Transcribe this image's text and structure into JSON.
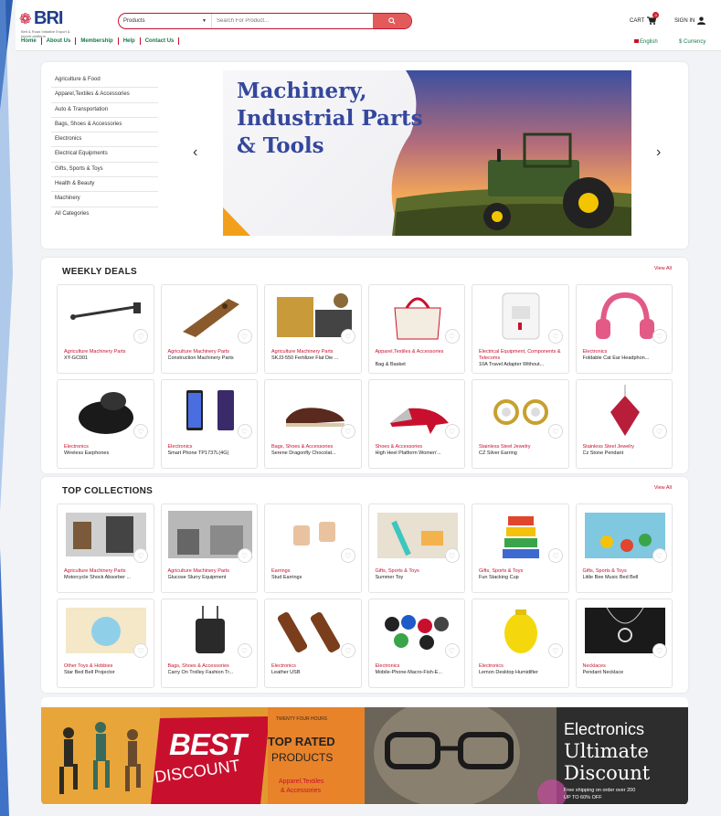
{
  "header": {
    "logo_text": "BRI",
    "logo_sub": "Belt & Road Initiative Export & Import platform",
    "search_category": "Products",
    "search_placeholder": "Search For Product...",
    "cart_label": "CART",
    "cart_count": "0",
    "signin_label": "SIGN IN"
  },
  "nav": [
    "Home",
    "About Us",
    "Membership",
    "Help",
    "Contact Us"
  ],
  "lang": "English",
  "currency": "$ Currency",
  "categories": [
    "Agriculture & Food",
    "Apparel,Textiles & Accessories",
    "Auto & Transportation",
    "Bags, Shoes & Accessories",
    "Electronics",
    "Electrical Equipments",
    "Gifts, Sports & Toys",
    "Health & Beauty",
    "Machinery",
    "All Categories"
  ],
  "banner": {
    "line1": "Machinery,",
    "line2": "Industrial Parts",
    "line3": "& Tools"
  },
  "weekly": {
    "title": "WEEKLY DEALS",
    "view_all": "View All",
    "products": [
      {
        "cat": "Agriculture Machinery Parts",
        "name": "XY-GC001",
        "img": "bar"
      },
      {
        "cat": "Agriculture Machinery Parts",
        "name": "Construction Machinery Parts",
        "img": "tooth"
      },
      {
        "cat": "Agriculture Machinery Parts",
        "name": "SKJ3-550 Fertilizer Flat Die ...",
        "img": "mill"
      },
      {
        "cat": "Apparel,Textiles & Accessories",
        "name": "Bag & Basket",
        "img": "bag"
      },
      {
        "cat": "Electrical Equipment, Components & Telecoms",
        "name": "10A Travel Adapter Without...",
        "img": "adapter"
      },
      {
        "cat": "Electronics",
        "name": "Foldable Cat Ear Headphon...",
        "img": "headphone"
      },
      {
        "cat": "Electronics",
        "name": "Wireless Earphones",
        "img": "earphone"
      },
      {
        "cat": "Electronics",
        "name": "Smart Phone TP1737L(4G)",
        "img": "phone"
      },
      {
        "cat": "Bags, Shoes & Accessories",
        "name": "Serene Dragonfly Chocolat...",
        "img": "shoe"
      },
      {
        "cat": "Shoes & Accessories",
        "name": "High Heel Platform Women'...",
        "img": "heel"
      },
      {
        "cat": "Stainless Steel Jewelry",
        "name": "CZ Silver Earring",
        "img": "earring"
      },
      {
        "cat": "Stainless Steel Jewelry",
        "name": "Cz Stone Pendant",
        "img": "pendant"
      }
    ]
  },
  "top": {
    "title": "TOP COLLECTIONS",
    "view_all": "View All",
    "products": [
      {
        "cat": "Agriculture Machinery Parts",
        "name": "Motorcycle Shock Absorber ...",
        "img": "shock"
      },
      {
        "cat": "Agriculture Machinery Parts",
        "name": "Glucose Slurry Equipment",
        "img": "factory"
      },
      {
        "cat": "Earrings",
        "name": "Stud Earrings",
        "img": "stud"
      },
      {
        "cat": "Gifts, Sports & Toys",
        "name": "Summer Toy",
        "img": "toy"
      },
      {
        "cat": "Gifts, Sports & Toys",
        "name": "Fun Stacking Cup",
        "img": "cups"
      },
      {
        "cat": "Gifts, Sports & Toys",
        "name": "Little Bee Music Bed Bell",
        "img": "bedbell"
      },
      {
        "cat": "Other Toys & Hobbies",
        "name": "Star Bed Bell Projector",
        "img": "projector"
      },
      {
        "cat": "Bags, Shoes & Accessories",
        "name": "Carry On Trolley Fashion Tr...",
        "img": "trolley"
      },
      {
        "cat": "Electronics",
        "name": "Leather USB",
        "img": "usb"
      },
      {
        "cat": "Electronics",
        "name": "Mobile-Phone-Macro-Fish-E...",
        "img": "lens"
      },
      {
        "cat": "Electronics",
        "name": "Lemon Desktop Humidifier",
        "img": "humidifier"
      },
      {
        "cat": "Necklaces",
        "name": "Pendant Necklace",
        "img": "necklace"
      }
    ]
  },
  "promo": {
    "best": "BEST",
    "discount": "DISCOUNT",
    "twenty": "TWENTY FOUR HOURS",
    "toprated": "TOP RATED",
    "products": "PRODUCTS",
    "apparel": "Apparel,Textiles",
    "access": "& Accessories",
    "electronics": "Electronics",
    "ultimate": "Ultimate",
    "disc2": "Discount",
    "ship": "Free shipping on order over 200",
    "upto": "UP TO 60% OFF"
  },
  "colors": {
    "brand_red": "#c8102e",
    "nav_green": "#157a4b",
    "title_blue": "#35479c"
  }
}
